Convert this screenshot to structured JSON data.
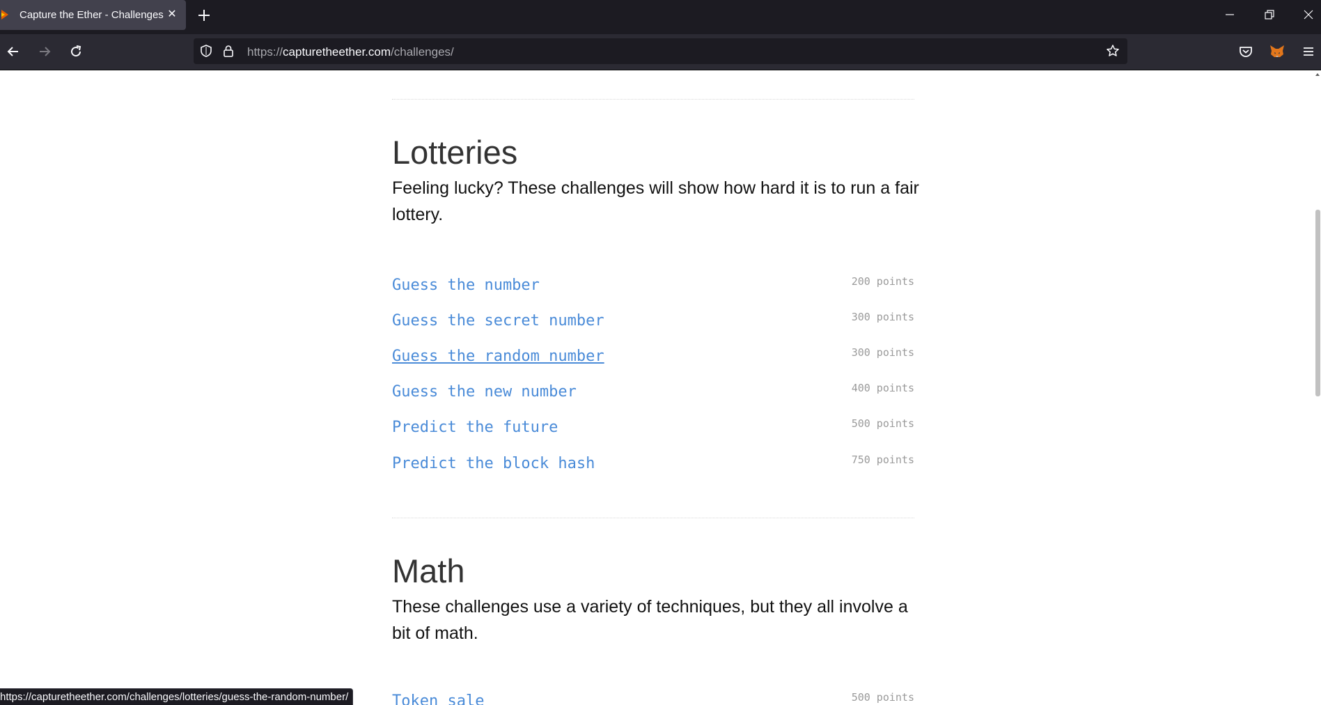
{
  "browser": {
    "tab_title": "Capture the Ether - Challenges",
    "url_prefix": "https://",
    "url_host": "capturetheether.com",
    "url_path": "/challenges/",
    "status_url": "https://capturetheether.com/challenges/lotteries/guess-the-random-number/"
  },
  "lotteries": {
    "title": "Lotteries",
    "description": "Feeling lucky? These challenges will show how hard it is to run a fair lottery.",
    "challenges": [
      {
        "name": "Guess the number",
        "points": "200 points"
      },
      {
        "name": "Guess the secret number",
        "points": "300 points"
      },
      {
        "name": "Guess the random number",
        "points": "300 points"
      },
      {
        "name": "Guess the new number",
        "points": "400 points"
      },
      {
        "name": "Predict the future",
        "points": "500 points"
      },
      {
        "name": "Predict the block hash",
        "points": "750 points"
      }
    ]
  },
  "math": {
    "title": "Math",
    "description": "These challenges use a variety of techniques, but they all involve a bit of math.",
    "challenges": [
      {
        "name": "Token sale",
        "points": "500 points"
      }
    ]
  },
  "colors": {
    "link": "#4a8bd8",
    "points": "#9a9a9a",
    "chrome_dark": "#1c1b22",
    "tab_active": "#42414d"
  },
  "icons": [
    "firefox-favicon",
    "close-icon",
    "plus-icon",
    "minimize-icon",
    "restore-icon",
    "window-close-icon",
    "back-arrow-icon",
    "forward-arrow-icon",
    "reload-icon",
    "shield-icon",
    "lock-icon",
    "star-icon",
    "pocket-icon",
    "metamask-fox-icon",
    "hamburger-menu-icon"
  ]
}
